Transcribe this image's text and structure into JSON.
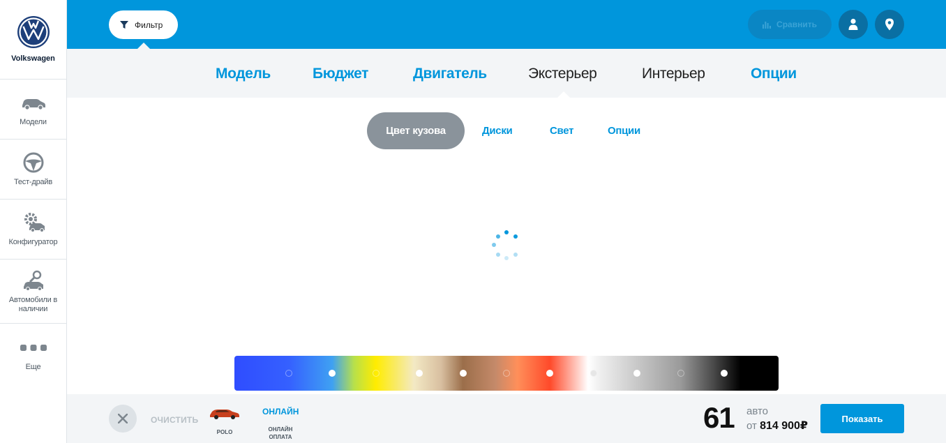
{
  "brand": {
    "name": "Volkswagen"
  },
  "sidebar": {
    "items": [
      {
        "label": "Модели",
        "icon": "car-icon"
      },
      {
        "label": "Тест-драйв",
        "icon": "steering-wheel-icon"
      },
      {
        "label": "Конфигуратор",
        "icon": "configurator-gear-car-icon"
      },
      {
        "label": "Автомобили в наличии",
        "icon": "car-search-icon"
      },
      {
        "label": "Еще",
        "icon": "more-dots-icon"
      }
    ]
  },
  "topbar": {
    "filter_label": "Фильтр",
    "compare_label": "Сравнить",
    "accent_color": "#0096dc"
  },
  "tabs": [
    {
      "label": "Модель",
      "active": false
    },
    {
      "label": "Бюджет",
      "active": false
    },
    {
      "label": "Двигатель",
      "active": false
    },
    {
      "label": "Экстерьер",
      "active": true
    },
    {
      "label": "Интерьер",
      "active": false
    },
    {
      "label": "Опции",
      "active": false
    }
  ],
  "subtabs": [
    {
      "label": "Цвет кузова",
      "active": true
    },
    {
      "label": "Диски",
      "active": false
    },
    {
      "label": "Свет",
      "active": false
    },
    {
      "label": "Опции",
      "active": false
    }
  ],
  "bottom": {
    "clear_label": "ОЧИСТИТЬ",
    "model_caption": "POLO",
    "online_label": "ОНЛАЙН",
    "online_caption": "ОНЛАЙН ОПЛАТА",
    "count": "61",
    "count_unit": "авто",
    "price_prefix": "от",
    "price": "814 900₽",
    "show_label": "Показать"
  }
}
